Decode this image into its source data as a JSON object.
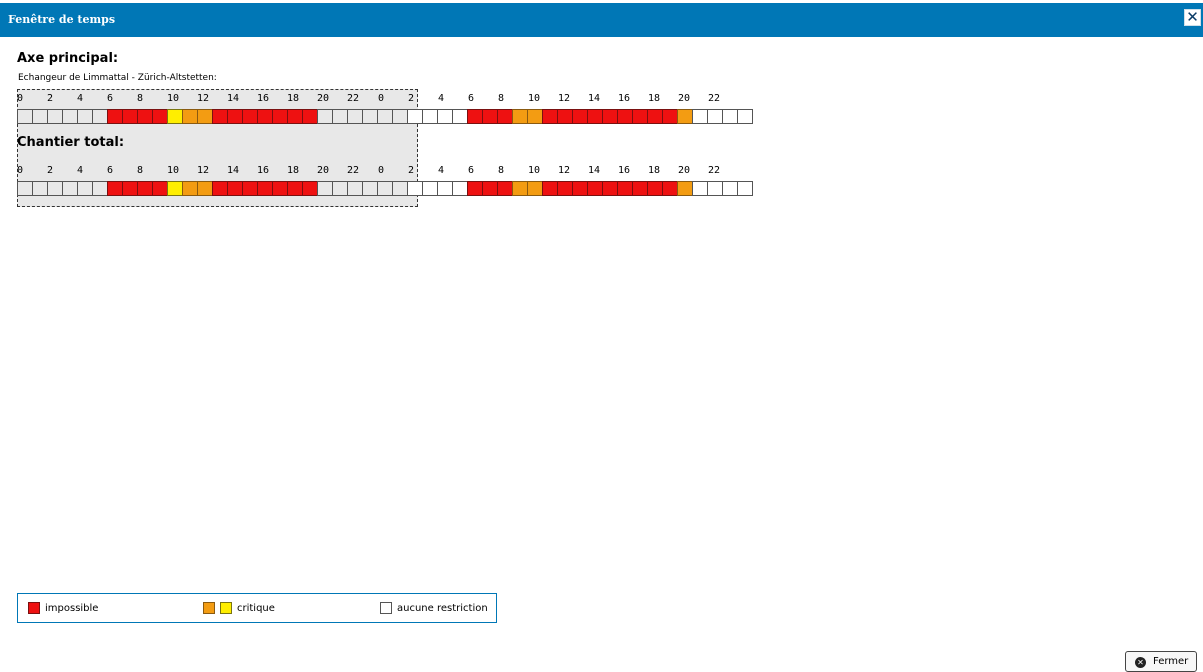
{
  "window": {
    "title": "Fenêtre de temps",
    "close_glyph": "✕"
  },
  "section_main": {
    "title": "Axe principal:",
    "subtitle": "Echangeur de Limmattal - Zürich-Altstetten:"
  },
  "section_total": {
    "title": "Chantier total:"
  },
  "hour_labels": [
    "0",
    "2",
    "4",
    "6",
    "8",
    "10",
    "12",
    "14",
    "16",
    "18",
    "20",
    "22",
    "0",
    "2",
    "4",
    "6",
    "8",
    "10",
    "12",
    "14",
    "16",
    "18",
    "20",
    "22"
  ],
  "colors": {
    "impossible": "#ee1111",
    "critique_orange": "#f39c12",
    "critique_yellow": "#ffee00",
    "aucune_restriction": "#ffffff",
    "accent": "#0077b6"
  },
  "timeline_main": {
    "cells": [
      "tr",
      "tr",
      "tr",
      "tr",
      "tr",
      "tr",
      "imp",
      "imp",
      "imp",
      "imp",
      "crit-y",
      "crit-o",
      "crit-o",
      "imp",
      "imp",
      "imp",
      "imp",
      "imp",
      "imp",
      "imp",
      "tr",
      "tr",
      "tr",
      "tr",
      "tr",
      "tr",
      "none",
      "none",
      "none",
      "none",
      "imp",
      "imp",
      "imp",
      "crit-o",
      "crit-o",
      "imp",
      "imp",
      "imp",
      "imp",
      "imp",
      "imp",
      "imp",
      "imp",
      "imp",
      "crit-o",
      "none",
      "none",
      "none",
      "none"
    ]
  },
  "timeline_total": {
    "cells": [
      "tr",
      "tr",
      "tr",
      "tr",
      "tr",
      "tr",
      "imp",
      "imp",
      "imp",
      "imp",
      "crit-y",
      "crit-o",
      "crit-o",
      "imp",
      "imp",
      "imp",
      "imp",
      "imp",
      "imp",
      "imp",
      "tr",
      "tr",
      "tr",
      "tr",
      "tr",
      "tr",
      "none",
      "none",
      "none",
      "none",
      "imp",
      "imp",
      "imp",
      "crit-o",
      "crit-o",
      "imp",
      "imp",
      "imp",
      "imp",
      "imp",
      "imp",
      "imp",
      "imp",
      "imp",
      "crit-o",
      "none",
      "none",
      "none",
      "none"
    ]
  },
  "legend": {
    "impossible": "impossible",
    "critique": "critique",
    "aucune_restriction": "aucune restriction"
  },
  "footer": {
    "close_label": "Fermer",
    "close_icon": "close-circle-icon"
  }
}
